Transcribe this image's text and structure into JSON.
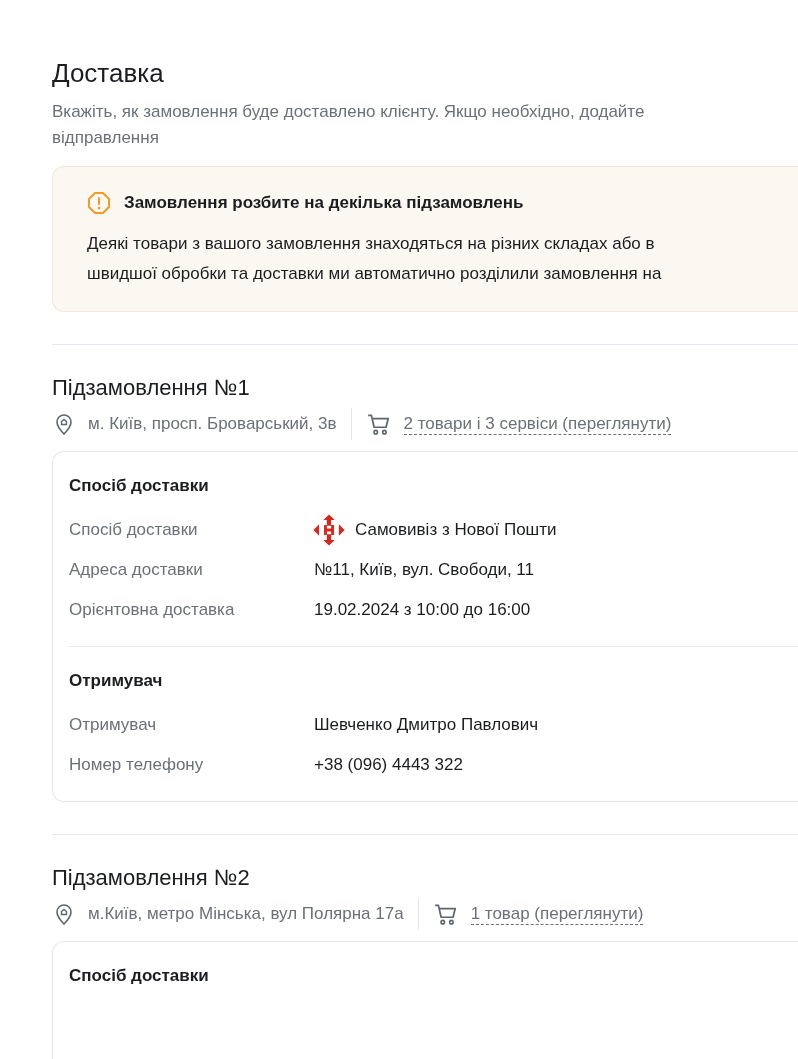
{
  "title": "Доставка",
  "subtitle": "Вкажіть, як замовлення буде доставлено клієнту. Якщо необхідно, додайте\nвідправлення",
  "alert": {
    "title": "Замовлення розбите на декілька підзамовлень",
    "text": "Деякі товари з вашого замовлення знаходяться на різних складах або в\nшвидшої обробки та доставки ми автоматично розділили замовлення на"
  },
  "orders": [
    {
      "title": "Підзамовлення №1",
      "address": "м. Київ, просп. Броварський, 3в",
      "items_link": "2 товари і 3 сервіси (переглянути)",
      "sections": [
        {
          "title": "Спосіб доставки",
          "rows": [
            {
              "kind": "carrier",
              "label": "Спосіб доставки",
              "value": "Самовивіз з Нової Пошти"
            },
            {
              "kind": "text",
              "label": "Адреса доставки",
              "value": "№11, Київ, вул. Свободи, 11"
            },
            {
              "kind": "text",
              "label": "Орієнтовна доставка",
              "value": "19.02.2024 з 10:00 до 16:00"
            }
          ]
        },
        {
          "title": "Отримувач",
          "rows": [
            {
              "kind": "text",
              "label": "Отримувач",
              "value": "Шевченко Дмитро Павлович"
            },
            {
              "kind": "text",
              "label": "Номер телефону",
              "value": "+38 (096) 4443 322"
            }
          ]
        }
      ]
    },
    {
      "title": "Підзамовлення №2",
      "address": "м.Київ, метро Мінська, вул Полярна 17а",
      "items_link": "1 товар (переглянути)",
      "sections": [
        {
          "title": "Спосіб доставки"
        }
      ]
    }
  ]
}
